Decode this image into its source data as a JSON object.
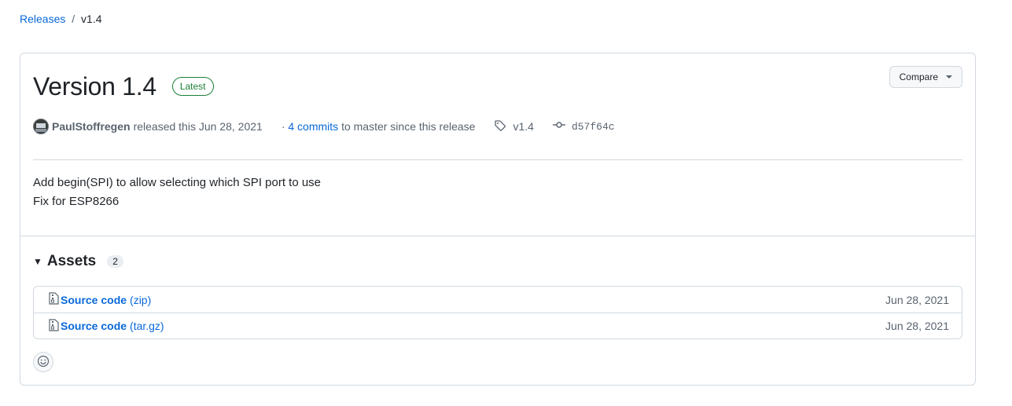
{
  "breadcrumb": {
    "parent": "Releases",
    "separator": "/",
    "current": "v1.4"
  },
  "release": {
    "title": "Version 1.4",
    "badge": "Latest",
    "author": "PaulStoffregen",
    "released_text": "released this Jun 28, 2021",
    "commits_prefix": "·",
    "commits_link": "4 commits",
    "commits_suffix": "to master since this release",
    "tag": "v1.4",
    "commit_sha": "d57f64c",
    "notes": [
      "Add begin(SPI) to allow selecting which SPI port to use",
      "Fix for ESP8266"
    ]
  },
  "compare_label": "Compare",
  "assets": {
    "title": "Assets",
    "count": "2",
    "items": [
      {
        "name": "Source code",
        "ext": "(zip)",
        "date": "Jun 28, 2021"
      },
      {
        "name": "Source code",
        "ext": "(tar.gz)",
        "date": "Jun 28, 2021"
      }
    ]
  },
  "colors": {
    "link": "#0969da",
    "latest": "#1a7f37",
    "border": "#d1d9e0",
    "muted": "#59636e"
  },
  "icons": [
    "tag-icon",
    "git-commit-icon",
    "file-zip-icon",
    "smiley-icon",
    "triangle-down-icon"
  ]
}
